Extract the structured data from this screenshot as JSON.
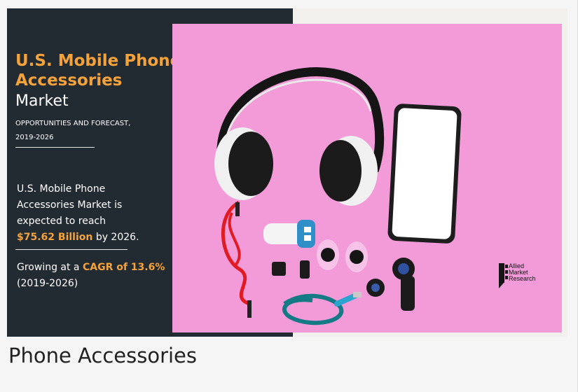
{
  "infographic": {
    "title_line1": "U.S. Mobile Phone",
    "title_line2": "Accessories",
    "title_line3": "Market",
    "subtitle_line1": "OPPORTUNITIES AND FORECAST,",
    "subtitle_line2": "2019-2026",
    "body1_line1": "U.S. Mobile Phone",
    "body1_line2": "Accessories Market is",
    "body1_line3": "expected to reach",
    "body1_value": "$75.62 Billion",
    "body1_tail": "by 2026.",
    "body2_pre": "Growing at a",
    "body2_highlight": "CAGR of 13.6%",
    "body2_tail": "(2019-2026)",
    "logo_line1": "Allied",
    "logo_line2": "Market",
    "logo_line3": "Research"
  },
  "caption": "Phone Accessories",
  "colors": {
    "dark_panel": "#232b32",
    "accent_orange": "#f6a23a",
    "photo_pink": "#f39ad9"
  }
}
